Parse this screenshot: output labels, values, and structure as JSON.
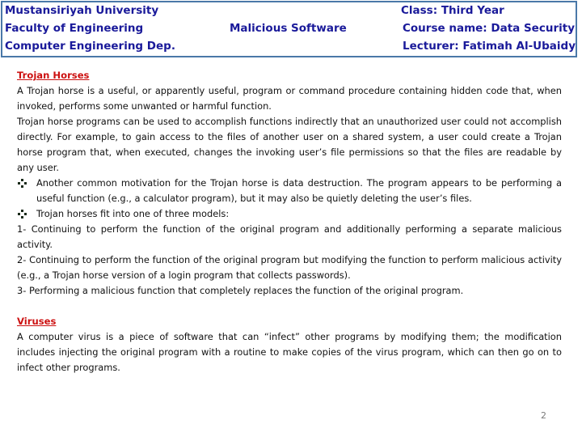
{
  "header": {
    "left_lines": [
      "Mustansiriyah University",
      "Faculty of Engineering",
      "Computer Engineering Dep."
    ],
    "center_title": "Malicious Software",
    "right_lines": [
      "Class: Third Year",
      "Course name: Data Security",
      "Lecturer: Fatimah Al-Ubaidy"
    ]
  },
  "colors": {
    "header_text": "#1a1a9a",
    "header_border": "#4a78a8",
    "section_title": "#cc1111",
    "body_text": "#111111"
  },
  "sections": {
    "trojan": {
      "title": "Trojan Horses",
      "para1": "A Trojan horse is a useful, or apparently useful, program or command procedure containing hidden code that, when invoked, performs some unwanted or harmful function.",
      "para2": "Trojan horse programs can be used to accomplish functions indirectly that an unauthorized user could not accomplish directly. For example, to gain access to the files of another user on a shared system, a user could create a Trojan horse program that, when executed, changes the invoking user’s file permissions so that the files are readable by any user.",
      "bullets": [
        {
          "icon": "diamond-bullet-icon",
          "text": "Another common motivation for the Trojan horse is data destruction. The program appears to be performing a useful function (e.g., a calculator program), but it may also be quietly deleting the user’s files."
        },
        {
          "icon": "diamond-bullet-icon",
          "text": "Trojan horses fit into one of three models:"
        }
      ],
      "models": [
        "1- Continuing to perform the function of the original program and additionally performing a separate malicious activity.",
        "2- Continuing to perform the function of the original program but modifying the function to perform malicious activity (e.g., a Trojan horse version of a login program that collects passwords).",
        "3- Performing a malicious function that completely replaces the function of the original program."
      ]
    },
    "viruses": {
      "title": "Viruses",
      "para1": "A computer virus is a piece of software that can “infect” other programs by modifying them; the modification includes injecting the original program with a routine to make copies of the virus program, which can then go on to infect other programs."
    }
  },
  "page_number": "2"
}
